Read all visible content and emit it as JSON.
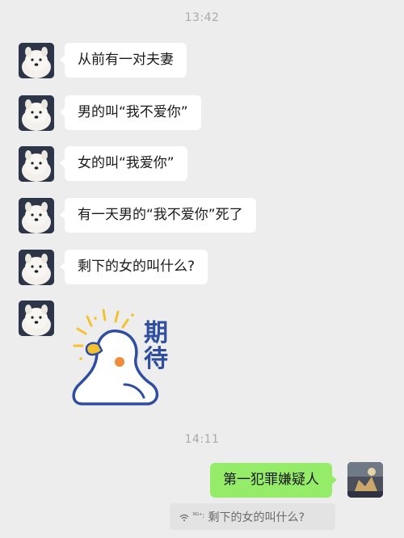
{
  "chat": {
    "timestamp1": "13:42",
    "timestamp2": "14:11",
    "messages_in": [
      "从前有一对夫妻",
      "男的叫“我不爱你”",
      "女的叫“我爱你”",
      "有一天男的“我不爱你”死了",
      "剩下的女的叫什么?"
    ],
    "sticker_text": [
      "期",
      "待"
    ],
    "message_out": "第一犯罪嫌疑人",
    "quote": {
      "network_label": "⁶ᴳ⁺:",
      "text": "剩下的女的叫什么?"
    }
  },
  "icons": {
    "avatar_in": "samoyed-dog-avatar",
    "avatar_out": "user-photo-avatar",
    "sticker": "duck-expecting-sticker",
    "quote_signal": "wifi-signal-icon"
  },
  "colors": {
    "background": "#ededed",
    "bubble_in": "#ffffff",
    "bubble_out": "#95ec69",
    "timestamp": "#a9a9a9",
    "sticker_text": "#2f4ea0"
  }
}
